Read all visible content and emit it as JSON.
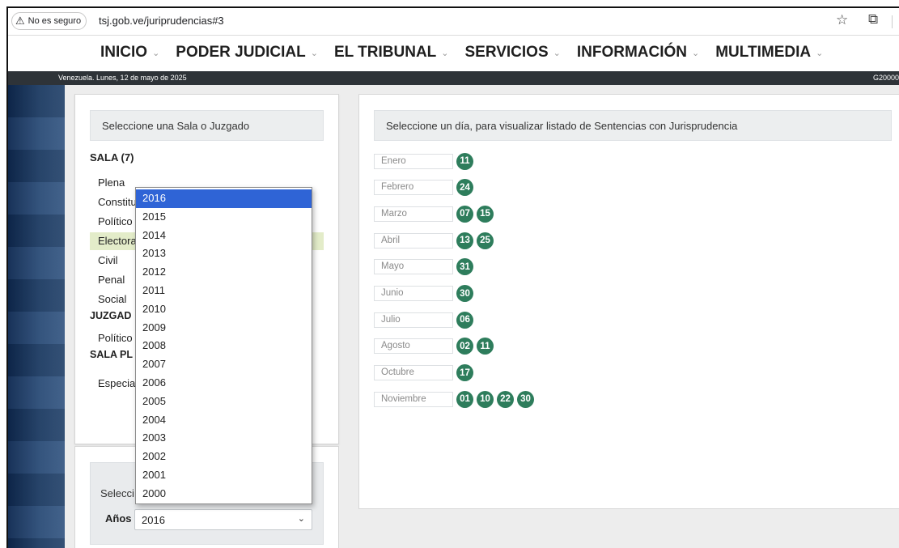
{
  "browser": {
    "security_label": "No es seguro",
    "url": "tsj.gob.ve/juriprudencias#3"
  },
  "menu": {
    "items": [
      {
        "label": "INICIO"
      },
      {
        "label": "PODER JUDICIAL"
      },
      {
        "label": "EL TRIBUNAL"
      },
      {
        "label": "SERVICIOS"
      },
      {
        "label": "INFORMACIÓN"
      },
      {
        "label": "MULTIMEDIA"
      }
    ]
  },
  "datebar": {
    "date": "Venezuela. Lunes, 12 de mayo de 2025",
    "code": "G20000"
  },
  "left_panel": {
    "header": "Seleccione una Sala o Juzgado",
    "sala_title": "SALA (7)",
    "salas": [
      "Plena",
      "Constitu",
      "Político",
      "Electora",
      "Civil",
      "Penal",
      "Social"
    ],
    "group_juzgado": "JUZGAD",
    "juzgado_item": "Político",
    "group_sala_plena": "SALA PL",
    "sala_plena_item": "Especia"
  },
  "year_panel": {
    "prompt": "Selecci",
    "label": "Años",
    "selected": "2016",
    "options": [
      "2016",
      "2015",
      "2014",
      "2013",
      "2012",
      "2011",
      "2010",
      "2009",
      "2008",
      "2007",
      "2006",
      "2005",
      "2004",
      "2003",
      "2002",
      "2001",
      "2000"
    ]
  },
  "right_panel": {
    "header": "Seleccione un día, para visualizar listado de Sentencias con Jurisprudencia",
    "months": [
      {
        "name": "Enero",
        "days": [
          "11"
        ]
      },
      {
        "name": "Febrero",
        "days": [
          "24"
        ]
      },
      {
        "name": "Marzo",
        "days": [
          "07",
          "15"
        ]
      },
      {
        "name": "Abril",
        "days": [
          "13",
          "25"
        ]
      },
      {
        "name": "Mayo",
        "days": [
          "31"
        ]
      },
      {
        "name": "Junio",
        "days": [
          "30"
        ]
      },
      {
        "name": "Julio",
        "days": [
          "06"
        ]
      },
      {
        "name": "Agosto",
        "days": [
          "02",
          "11"
        ]
      },
      {
        "name": "Octubre",
        "days": [
          "17"
        ]
      },
      {
        "name": "Noviembre",
        "days": [
          "01",
          "10",
          "22",
          "30"
        ]
      }
    ]
  },
  "colors": {
    "day_badge": "#2e7d5c",
    "selected_option": "#2f64d6",
    "active_sala": "#e3ecc9",
    "datebar": "#2e3338"
  }
}
